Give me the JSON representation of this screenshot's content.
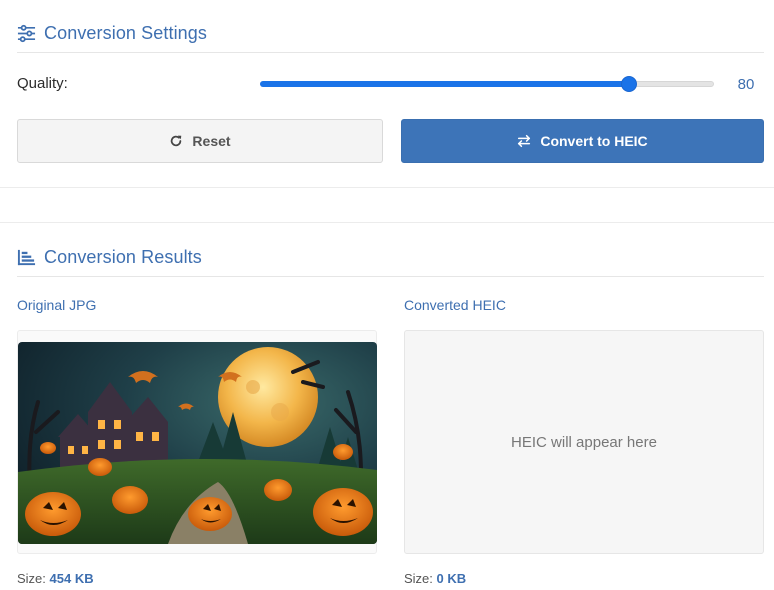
{
  "settings": {
    "title": "Conversion Settings",
    "icon": "sliders-icon",
    "quality_label": "Quality:",
    "quality_value": "80",
    "quality_fraction": 0.8,
    "reset_label": "Reset",
    "reset_icon": "refresh-icon",
    "convert_label": "Convert to HEIC",
    "convert_icon": "swap-arrows-icon",
    "accent_color": "#3d74b8",
    "slider_color": "#1a73e8"
  },
  "results": {
    "title": "Conversion Results",
    "icon": "bar-chart-icon",
    "original": {
      "label": "Original JPG",
      "size_prefix": "Size: ",
      "size_value": "454 KB"
    },
    "converted": {
      "label": "Converted HEIC",
      "placeholder": "HEIC will appear here",
      "size_prefix": "Size: ",
      "size_value": "0 KB"
    }
  }
}
